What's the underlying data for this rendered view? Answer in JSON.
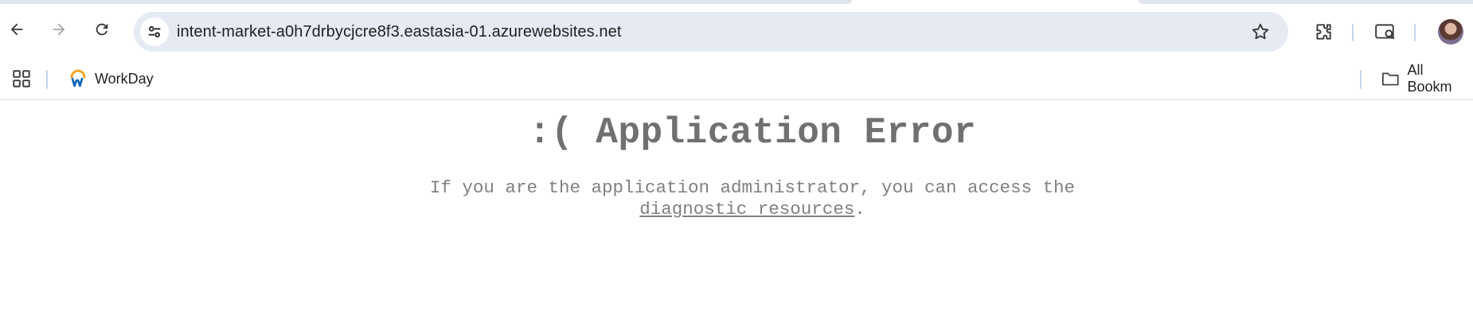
{
  "browser": {
    "url": "intent-market-a0h7drbycjcre8f3.eastasia-01.azurewebsites.net",
    "icons": {
      "back": "arrow-left-icon",
      "forward": "arrow-right-icon",
      "reload": "reload-icon",
      "site_info": "tune-icon",
      "bookmark": "star-icon",
      "extensions": "puzzle-icon",
      "screen_search": "screen-search-icon",
      "profile": "avatar"
    },
    "colors": {
      "omnibox_bg": "#e6ebf3",
      "workday_orange": "#f5a623",
      "workday_blue": "#0062b8"
    }
  },
  "bookmarks_bar": {
    "apps_icon": "apps-grid-icon",
    "items": [
      {
        "label": "WorkDay",
        "icon": "workday-logo"
      }
    ],
    "all_bookmarks_label": "All Bookm"
  },
  "page": {
    "title": ":( Application Error",
    "message_line1": "If you are the application administrator, you can access the",
    "link_text": "diagnostic resources",
    "message_end": "."
  }
}
